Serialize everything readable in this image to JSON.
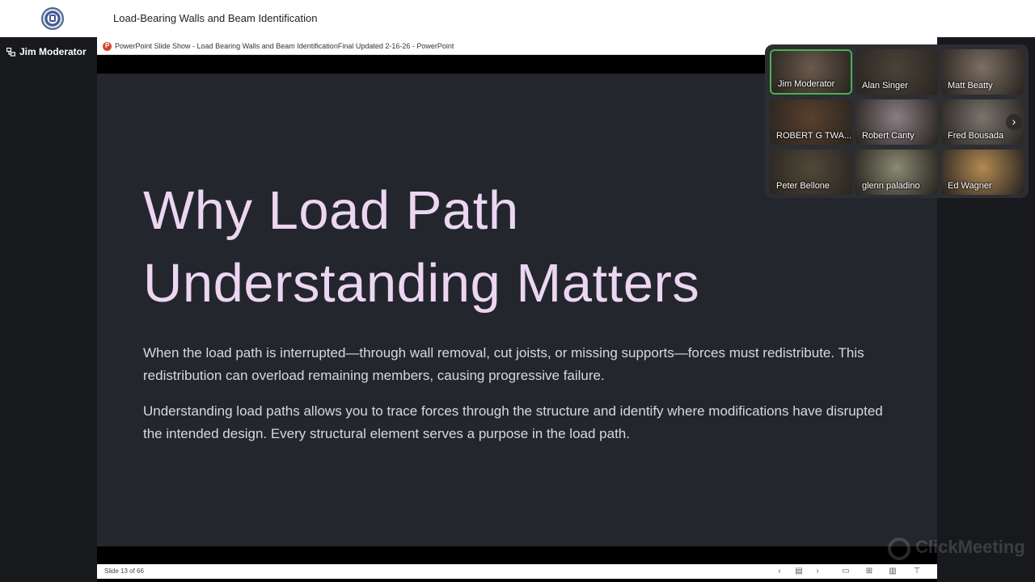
{
  "app": {
    "webinar_title": "Load-Bearing Walls and Beam Identification",
    "presenter_name": "Jim Moderator",
    "watermark": "ClickMeeting"
  },
  "powerpoint": {
    "window_title": "PowerPoint Slide Show  -  Load Bearing Walls and Beam IdentificationFinal Updated 2-16-26 - PowerPoint",
    "slide_counter": "Slide 13 of 66"
  },
  "slide": {
    "heading_line1": "Why Load Path",
    "heading_line2": "Understanding Matters",
    "paragraph1": "When the load path is interrupted—through wall removal, cut joists, or missing supports—forces must redistribute. This redistribution can overload remaining members, causing progressive failure.",
    "paragraph2": "Understanding load paths allows you to trace forces through the structure and identify where modifications have disrupted the intended design. Every structural element serves a purpose in the load path."
  },
  "participants": [
    {
      "name": "Jim Moderator",
      "color": "#6b5a4c"
    },
    {
      "name": "Alan Singer",
      "color": "#4a4238"
    },
    {
      "name": "Matt Beatty",
      "color": "#7d6f63"
    },
    {
      "name": "ROBERT G TWA...",
      "color": "#5a3f2c"
    },
    {
      "name": "Robert Canty",
      "color": "#8b7e83"
    },
    {
      "name": "Fred Bousada",
      "color": "#7a746c"
    },
    {
      "name": "Peter Bellone",
      "color": "#514838"
    },
    {
      "name": "glenn paladino",
      "color": "#8a8a72"
    },
    {
      "name": "Ed Wagner",
      "color": "#b48a52"
    }
  ],
  "icons": {
    "presenter": "presenter-icon",
    "next_page": "chevron-right-icon",
    "statusbar": [
      "chevron-left-icon",
      "slide-menu-icon",
      "chevron-right-icon",
      "normal-view-icon",
      "slide-sorter-icon",
      "reading-view-icon",
      "slideshow-icon"
    ]
  }
}
